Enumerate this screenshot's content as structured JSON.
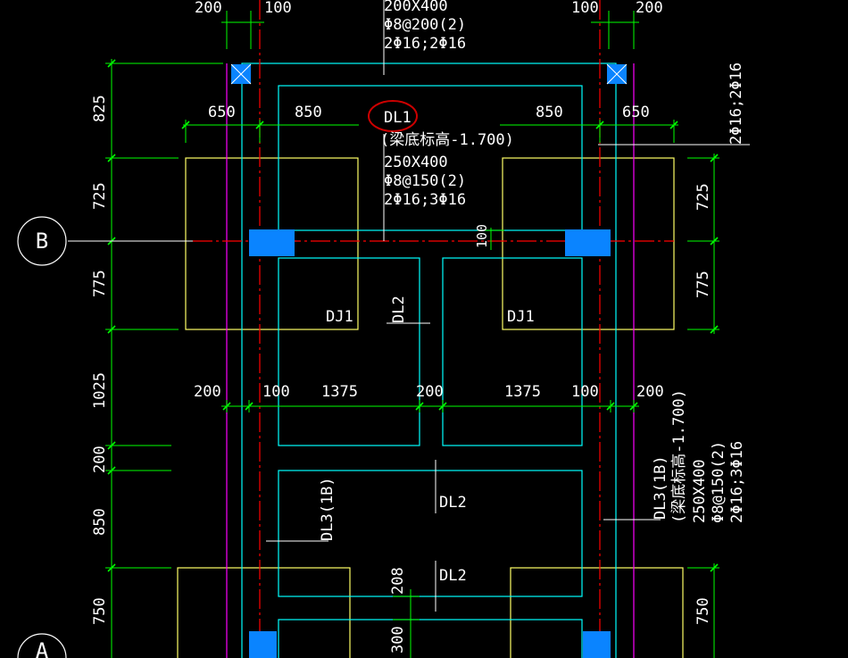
{
  "colors": {
    "background": "#000000",
    "dimension": "#00ff00",
    "axis": "#ff0000",
    "foundation_outline": "#ffff66",
    "beam_outline": "#00ffff",
    "column_fill": "#0a84ff",
    "wall_line": "#ff00ff",
    "text": "#ffffff",
    "highlight_circle": "#cc0000"
  },
  "axes": {
    "row_b": "B",
    "row_a": "A"
  },
  "dims_top": {
    "d200": "200",
    "d100": "100",
    "d100_r": "100",
    "d200_r": "200"
  },
  "dims_row1": {
    "left650": "650",
    "left850": "850",
    "right850": "850",
    "right650": "650"
  },
  "dims_row2": {
    "a": "200",
    "b": "100",
    "c": "1375",
    "d": "200",
    "e": "1375",
    "f": "100",
    "g": "200"
  },
  "dims_left": {
    "d825": "825",
    "d725": "725",
    "d775": "775",
    "d1025": "1025",
    "d200": "200",
    "d850": "850",
    "d750": "750"
  },
  "dims_right": {
    "d725": "725",
    "d775": "775",
    "d750": "750"
  },
  "dims_inner": {
    "d100": "100",
    "d208": "208",
    "d300": "300"
  },
  "top_beam_note": {
    "line1": "200X400",
    "line2": "Φ8@200(2)",
    "line3": "2Φ16;2Φ16"
  },
  "right_top_note": "2Φ16;2Φ16",
  "dl1_note": {
    "name": "DL1",
    "line2": "(梁底标高-1.700)",
    "line3": "250X400",
    "line4": "Φ8@150(2)",
    "line5": "2Φ16;3Φ16"
  },
  "labels": {
    "dj1_left": "DJ1",
    "dj1_right": "DJ1",
    "dl2_upper": "DL2",
    "dl2_mid": "DL2",
    "dl2_lower": "DL2",
    "dl3_left": "DL3(1B)"
  },
  "dl3_note": {
    "line1": "DL3(1B)",
    "line2": "(梁底标高-1.700)",
    "line3": "250X400",
    "line4": "Φ8@150(2)",
    "line5": "2Φ16;3Φ16"
  }
}
